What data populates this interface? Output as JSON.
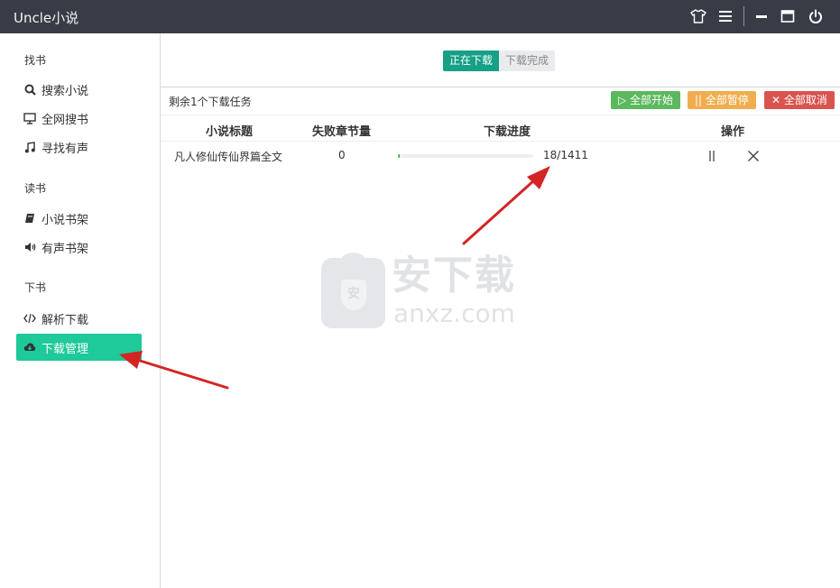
{
  "titlebar": {
    "title": "Uncle小说",
    "icons": [
      "shirt-icon",
      "menu-icon",
      "minimize-icon",
      "maximize-icon",
      "power-icon"
    ]
  },
  "sidebar": {
    "sections": [
      {
        "title": "找书",
        "items": [
          {
            "label": "搜索小说",
            "icon": "search-icon"
          },
          {
            "label": "全网搜书",
            "icon": "monitor-icon"
          },
          {
            "label": "寻找有声",
            "icon": "music-icon"
          }
        ]
      },
      {
        "title": "读书",
        "items": [
          {
            "label": "小说书架",
            "icon": "book-icon"
          },
          {
            "label": "有声书架",
            "icon": "speaker-icon"
          }
        ]
      },
      {
        "title": "下书",
        "items": [
          {
            "label": "解析下载",
            "icon": "code-icon"
          },
          {
            "label": "下载管理",
            "icon": "cloud-download-icon",
            "active": true
          }
        ]
      }
    ]
  },
  "main": {
    "tabs": [
      {
        "label": "正在下载",
        "active": true
      },
      {
        "label": "下载完成",
        "active": false
      }
    ],
    "remaining_text": "剩余1个下载任务",
    "buttons": {
      "start_all": "▷ 全部开始",
      "pause_all": "|| 全部暂停",
      "cancel_all": "✕ 全部取消"
    },
    "table": {
      "headers": [
        "小说标题",
        "失败章节量",
        "下载进度",
        "操作"
      ],
      "rows": [
        {
          "title": "凡人修仙传仙界篇全文",
          "failed": "0",
          "progress_text": "18/1411",
          "progress_fraction": 0.0128
        }
      ]
    }
  },
  "watermark": {
    "cn": "安下载",
    "en": "anxz.com",
    "shield": "安"
  },
  "colors": {
    "titlebar": "#383c46",
    "active_nav": "#1ec99a",
    "active_tab": "#16a085",
    "start": "#5cb85c",
    "pause": "#f0ad4e",
    "cancel": "#d9534f",
    "arrow": "#d42424"
  }
}
